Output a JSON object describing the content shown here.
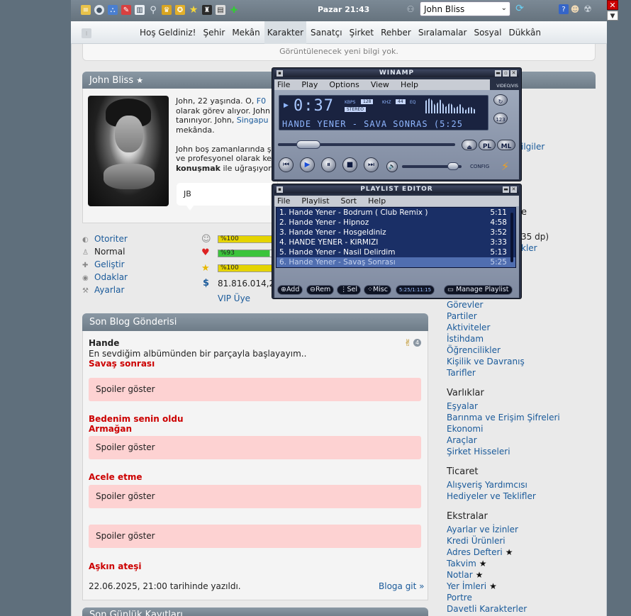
{
  "topbar": {
    "clock": "Pazar 21:43",
    "character_select": "John Bliss"
  },
  "nav": {
    "items": [
      "Hoş Geldiniz!",
      "Şehir",
      "Mekân",
      "Karakter",
      "Sanatçı",
      "Şirket",
      "Rehber",
      "Sıralamalar",
      "Sosyal",
      "Dükkân"
    ],
    "active": "Karakter"
  },
  "notice": "Görüntülenecek yeni bilgi yok.",
  "profile": {
    "name": "John Bliss",
    "star": "★",
    "bio_line1a": "John, 22 yaşında. O, ",
    "bio_link1": "F0",
    "bio_line2": "olarak görev alıyor. John",
    "bio_line3": "tanınıyor. John, ",
    "bio_link2": "Singapu",
    "bio_line4": "mekânda.",
    "bio_line5": "John boş zamanlarında ş",
    "bio_line6": "ve profesyonel olarak ke",
    "bio_bold": "konuşmak",
    "bio_line7": " ile uğraşıyor",
    "bubble": "JB"
  },
  "stats_left": [
    {
      "icon": "authority-icon",
      "label": "Otoriter"
    },
    {
      "icon": "person-icon",
      "label": "Normal"
    },
    {
      "icon": "plus-icon",
      "label": "Geliştir"
    },
    {
      "icon": "eye-icon",
      "label": "Odaklar"
    },
    {
      "icon": "wrench-icon",
      "label": "Ayarlar"
    }
  ],
  "bars": [
    {
      "label": "%100",
      "value": 100,
      "color": "#e5d400"
    },
    {
      "label": "%93",
      "value": 93,
      "color": "#3bc43b"
    },
    {
      "label": "%100",
      "value": 100,
      "color": "#e5d400"
    }
  ],
  "money": "81.816.014,2",
  "vip": "VIP Üye",
  "blog": {
    "header": "Son Blog Gönderisi",
    "title": "Hande",
    "intro": "En sevdiğim albümünden bir parçayla başlayayım..",
    "song1": "Savaş sonrası",
    "spoiler": "Spoiler göster",
    "song2a": "Bedenim senin oldu",
    "song2b": "Armağan",
    "song3": "Acele etme",
    "song4": "Aşkın ateşi",
    "date": "22.06.2025, 21:00 tarihinde yazıldı.",
    "more": "Bloga git »",
    "badge_count": "4"
  },
  "next_header": "Son Günlük Kayıtları",
  "right": {
    "partial1": "ilgiler",
    "partial2": "e",
    "partial3": "35 dp)",
    "partial4": "kler",
    "links1": [
      "Görevler",
      "Partiler",
      "Aktiviteler",
      "İstihdam",
      "Öğrencilikler",
      "Kişilik ve Davranış",
      "Tarifler"
    ],
    "h_varliklar": "Varlıklar",
    "links2": [
      "Eşyalar",
      "Barınma ve Erişim Şifreleri",
      "Ekonomi",
      "Araçlar",
      "Şirket Hisseleri"
    ],
    "h_ticaret": "Ticaret",
    "links3": [
      "Alışveriş Yardımcısı",
      "Hediyeler ve Teklifler"
    ],
    "h_ekstralar": "Ekstralar",
    "links4": [
      "Ayarlar ve İzinler",
      "Kredi Ürünleri",
      "Adres Defteri",
      "Takvim",
      "Notlar",
      "Yer İmleri",
      "Portre",
      "Davetli Karakterler"
    ],
    "star": "★"
  },
  "winamp": {
    "title": "WINAMP",
    "menu": [
      "File",
      "Play",
      "Options",
      "View",
      "Help"
    ],
    "time": "0:37",
    "kbps_label": "KBPS",
    "kbps": "128",
    "khz_label": "KHZ",
    "khz": "44",
    "eq": "EQ",
    "stereo": "STEREO",
    "scroll": "HANDE YENER - SAVA  SONRAS  (5:25",
    "pl_btn": "PL",
    "ml_btn": "ML",
    "video_vis": "VIDEO/VIS",
    "config": "CONFIG"
  },
  "playlist": {
    "title": "PLAYLIST EDITOR",
    "menu": [
      "File",
      "Playlist",
      "Sort",
      "Help"
    ],
    "tracks": [
      {
        "name": "1. Hande Yener - Bodrum ( Club Remix )",
        "time": "5:11"
      },
      {
        "name": "2. Hande Yener - Hipnoz",
        "time": "4:58"
      },
      {
        "name": "3. Hande Yener - Hosgeldiniz",
        "time": "3:52"
      },
      {
        "name": "4. HANDE YENER - KIRMIZI",
        "time": "3:33"
      },
      {
        "name": "5. Hande Yener - Nasil Delirdim",
        "time": "5:13"
      },
      {
        "name": "6. Hande Yener - Savaş Sonrası",
        "time": "5:25"
      }
    ],
    "buttons": [
      "Add",
      "Rem",
      "Sel",
      "Misc"
    ],
    "total": "5:25/1:11:15",
    "manage": "Manage Playlist"
  },
  "colors": {
    "accent_red": "#cc0000",
    "link": "#1a5a9a",
    "spoiler_bg": "#fdd2d2"
  }
}
